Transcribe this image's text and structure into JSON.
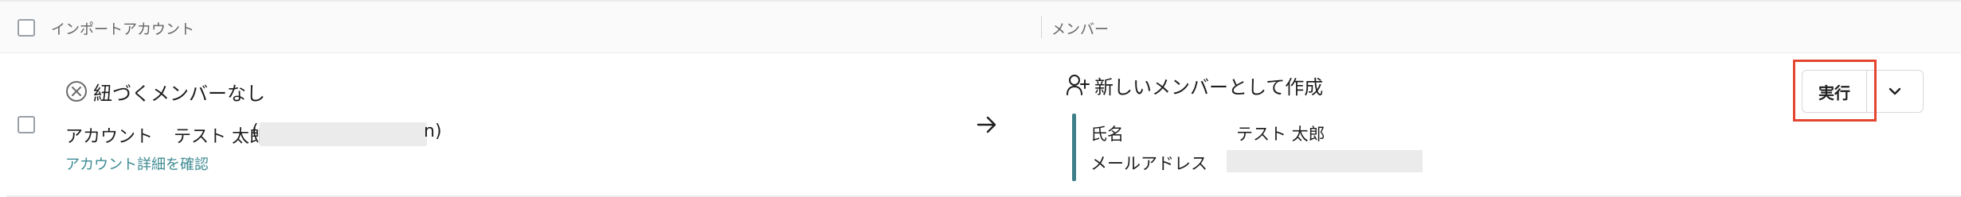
{
  "header": {
    "col_import_account": "インポートアカウント",
    "col_member": "メンバー"
  },
  "row": {
    "status_text": "紐づくメンバーなし",
    "account_label": "アカウント",
    "account_name": "テスト 太郎",
    "paren_open": "(",
    "email_tail": "n)",
    "detail_link": "アカウント詳細を確認",
    "action_text": "新しいメンバーとして作成",
    "fields": {
      "name_label": "氏名",
      "name_value": "テスト 太郎",
      "mail_label": "メールアドレス"
    },
    "run_button": "実行"
  },
  "colors": {
    "accent": "#3f7f89",
    "link": "#3d8a93",
    "highlight": "#e3452e"
  },
  "icons": {
    "status": "x-circle-icon",
    "arrow": "arrow-right-icon",
    "create": "user-plus-icon",
    "dropdown": "chevron-down-icon"
  }
}
